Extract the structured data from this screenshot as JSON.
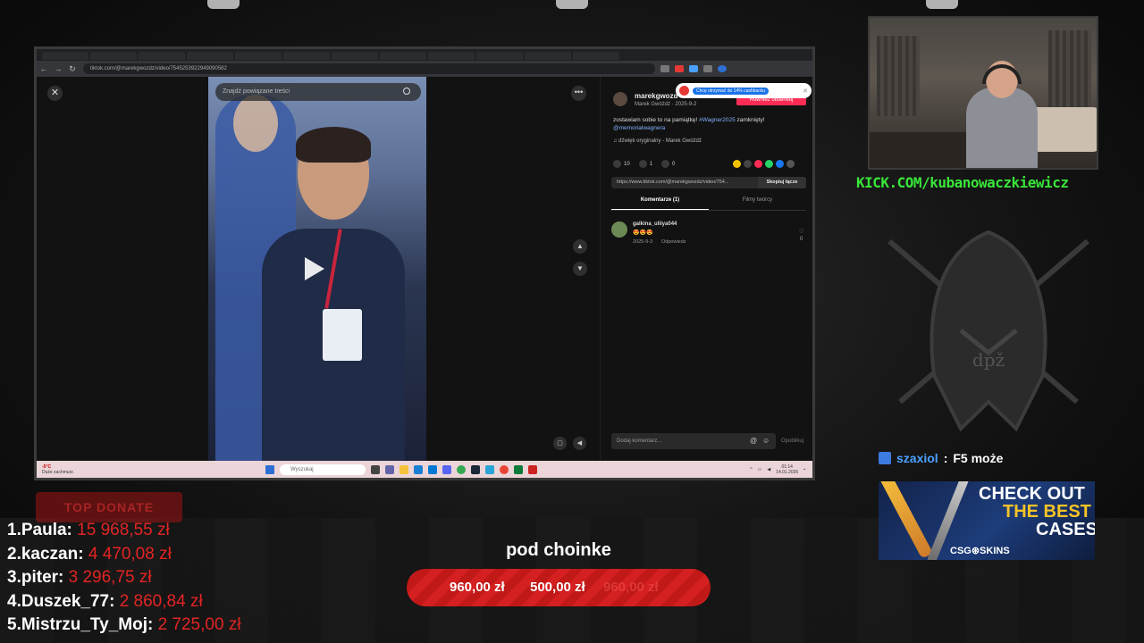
{
  "browser": {
    "tabs": [
      "",
      "",
      "",
      "",
      "",
      "",
      "",
      "",
      "",
      "",
      "",
      ""
    ],
    "url": "tiktok.com/@marekgwozdz/video/7545253922949090582",
    "nav_back": "←",
    "nav_forward": "→",
    "nav_reload": "↻"
  },
  "tiktok": {
    "close": "✕",
    "search_placeholder": "Znajdź powiązane treści",
    "more": "•••",
    "arrow_up": "▲",
    "arrow_down": "▼",
    "username": "marekgwozd",
    "author_meta": "Marek Gwóźdź · 2025-9-2",
    "follow_label": "Rowniez obserwuj",
    "cashback_text": "Chcę otrzymać do 14% cashbacku",
    "caption_text": "zostawiam sobie to na pamiątkę! ",
    "caption_tag": "#Wagner2025",
    "caption_after": " zamknięty!",
    "caption_mention": "@memorialwagnera",
    "sound": "♫  dźwięk oryginalny - Marek Gwóźdź",
    "likes": "10",
    "comments": "1",
    "saves": "0",
    "link": "https://www.tiktok.com/@marekgwozdz/video/754...",
    "copy_label": "Skopiuj łącze",
    "tab_comments": "Komentarze (1)",
    "tab_creator": "Filmy twórcy",
    "comment": {
      "user": "galkina_uliiya044",
      "emoji": "😍😍😍",
      "date": "2025-9-3",
      "reply": "Odpowiedz",
      "likes": "0"
    },
    "add_comment_placeholder": "Dodaj komentarz...",
    "publish": "Opublikuj"
  },
  "taskbar": {
    "weather_temp": "-5°C",
    "weather_desc": "Duże zachmurz.",
    "search_placeholder": "Wyszukaj",
    "time": "01:14",
    "date": "14.01.2026"
  },
  "overlay": {
    "kick_url": "KICK.COM/kubanowaczkiewicz",
    "chat_user": "szaxiol",
    "chat_message": "F5 może",
    "ad": {
      "line1": "CHECK OUT",
      "line2": "THE BEST",
      "line3": "CASES",
      "brand": "CSG⊛SKINS"
    },
    "top_donate_label": "TOP DONATE",
    "donors": [
      {
        "rank": "1.",
        "name": "Paula:",
        "amount": "15 968,55 zł"
      },
      {
        "rank": "2.",
        "name": "kaczan:",
        "amount": "4 470,08 zł"
      },
      {
        "rank": "3.",
        "name": "piter:",
        "amount": "3 296,75 zł"
      },
      {
        "rank": "4.",
        "name": "Duszek_77:",
        "amount": "2 860,84 zł"
      },
      {
        "rank": "5.",
        "name": "Mistrzu_Ty_Moj:",
        "amount": "2 725,00 zł"
      }
    ],
    "goal": {
      "title": "pod choinke",
      "current": "960,00 zł",
      "target": "500,00 zł",
      "ghost": "960,00 zł"
    }
  },
  "colors": {
    "kick_green": "#39e63a",
    "donation_red": "#e32424",
    "tiktok_pink": "#fe2c55"
  }
}
